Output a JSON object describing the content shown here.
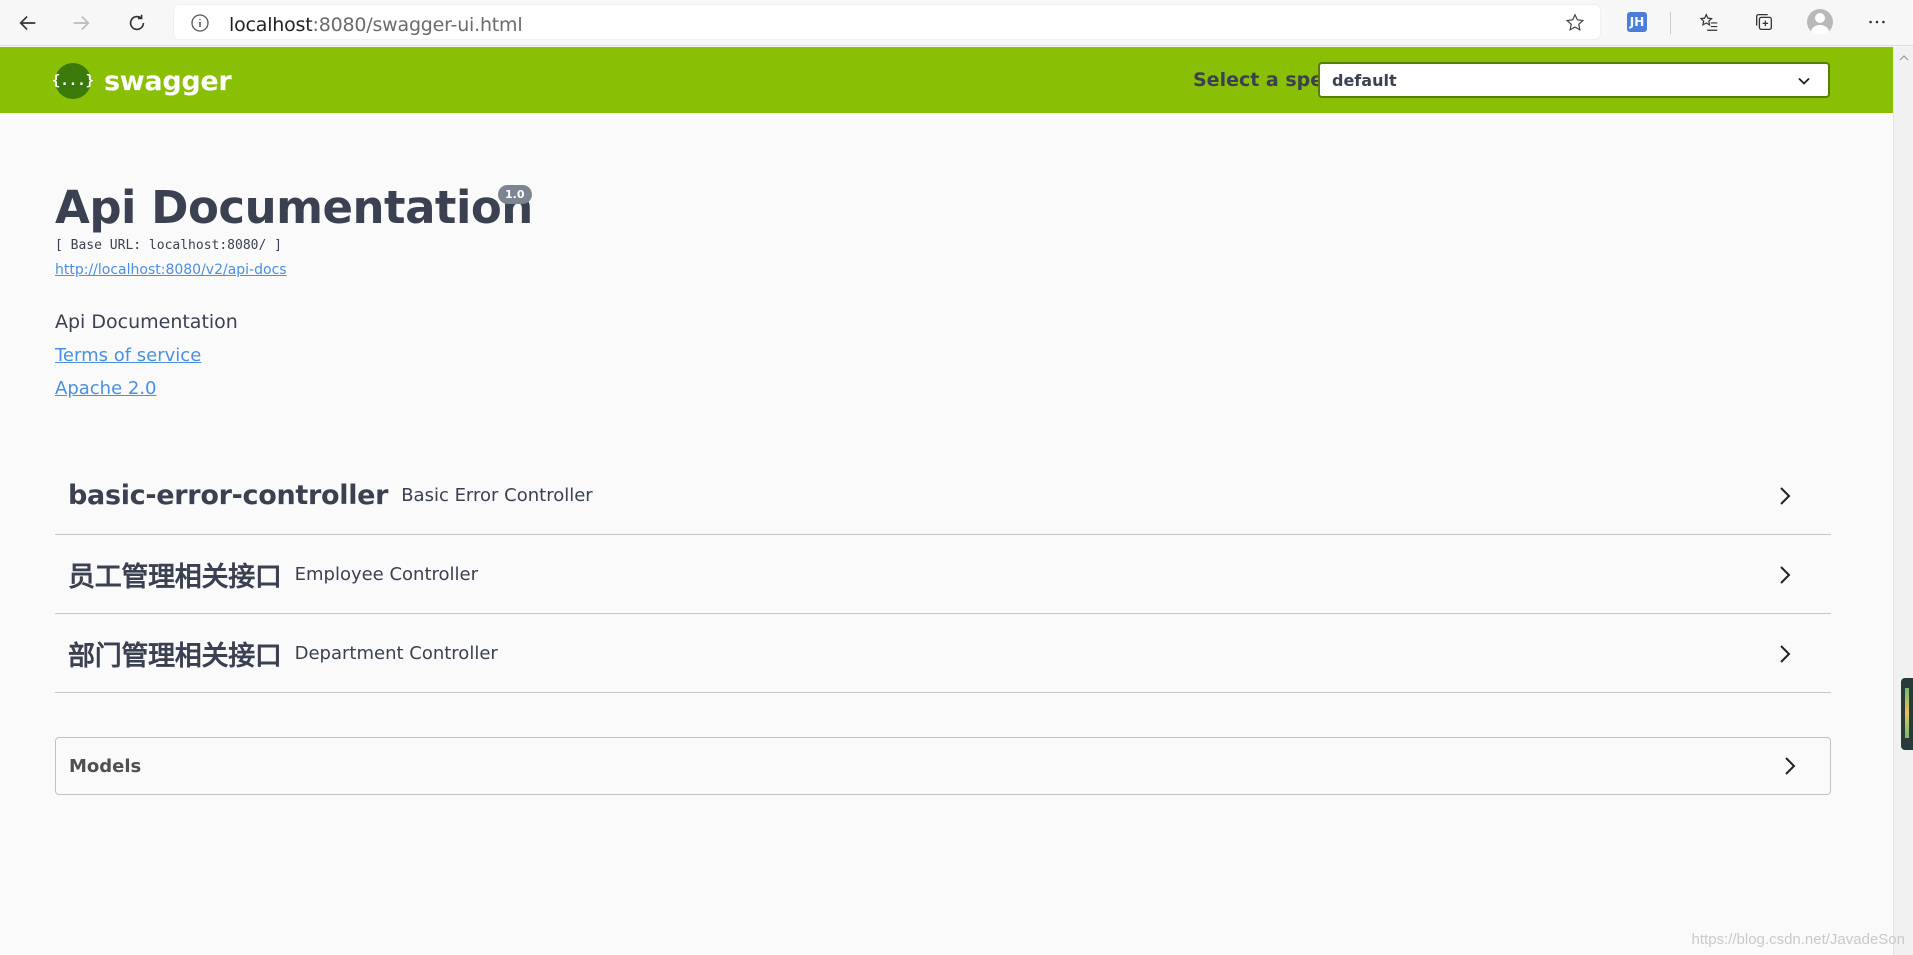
{
  "browser": {
    "url_host": "localhost",
    "url_path": ":8080/swagger-ui.html",
    "profile_badge": "JH"
  },
  "topbar": {
    "logo_glyph": "{...}",
    "logo_text": "swagger",
    "spec_label": "Select a spec",
    "spec_selected": "default",
    "bg_color": "#89bf04"
  },
  "info": {
    "title": "Api Documentation",
    "version": "1.0",
    "base_url": "[ Base URL: localhost:8080/ ]",
    "docs_link": "http://localhost:8080/v2/api-docs",
    "description": "Api Documentation",
    "terms": "Terms of service",
    "license": "Apache 2.0"
  },
  "tags": [
    {
      "name": "basic-error-controller",
      "description": "Basic Error Controller"
    },
    {
      "name": "员工管理相关接口",
      "description": "Employee Controller"
    },
    {
      "name": "部门管理相关接口",
      "description": "Department Controller"
    }
  ],
  "models": {
    "label": "Models"
  },
  "watermark": "https://blog.csdn.net/JavadeSon"
}
